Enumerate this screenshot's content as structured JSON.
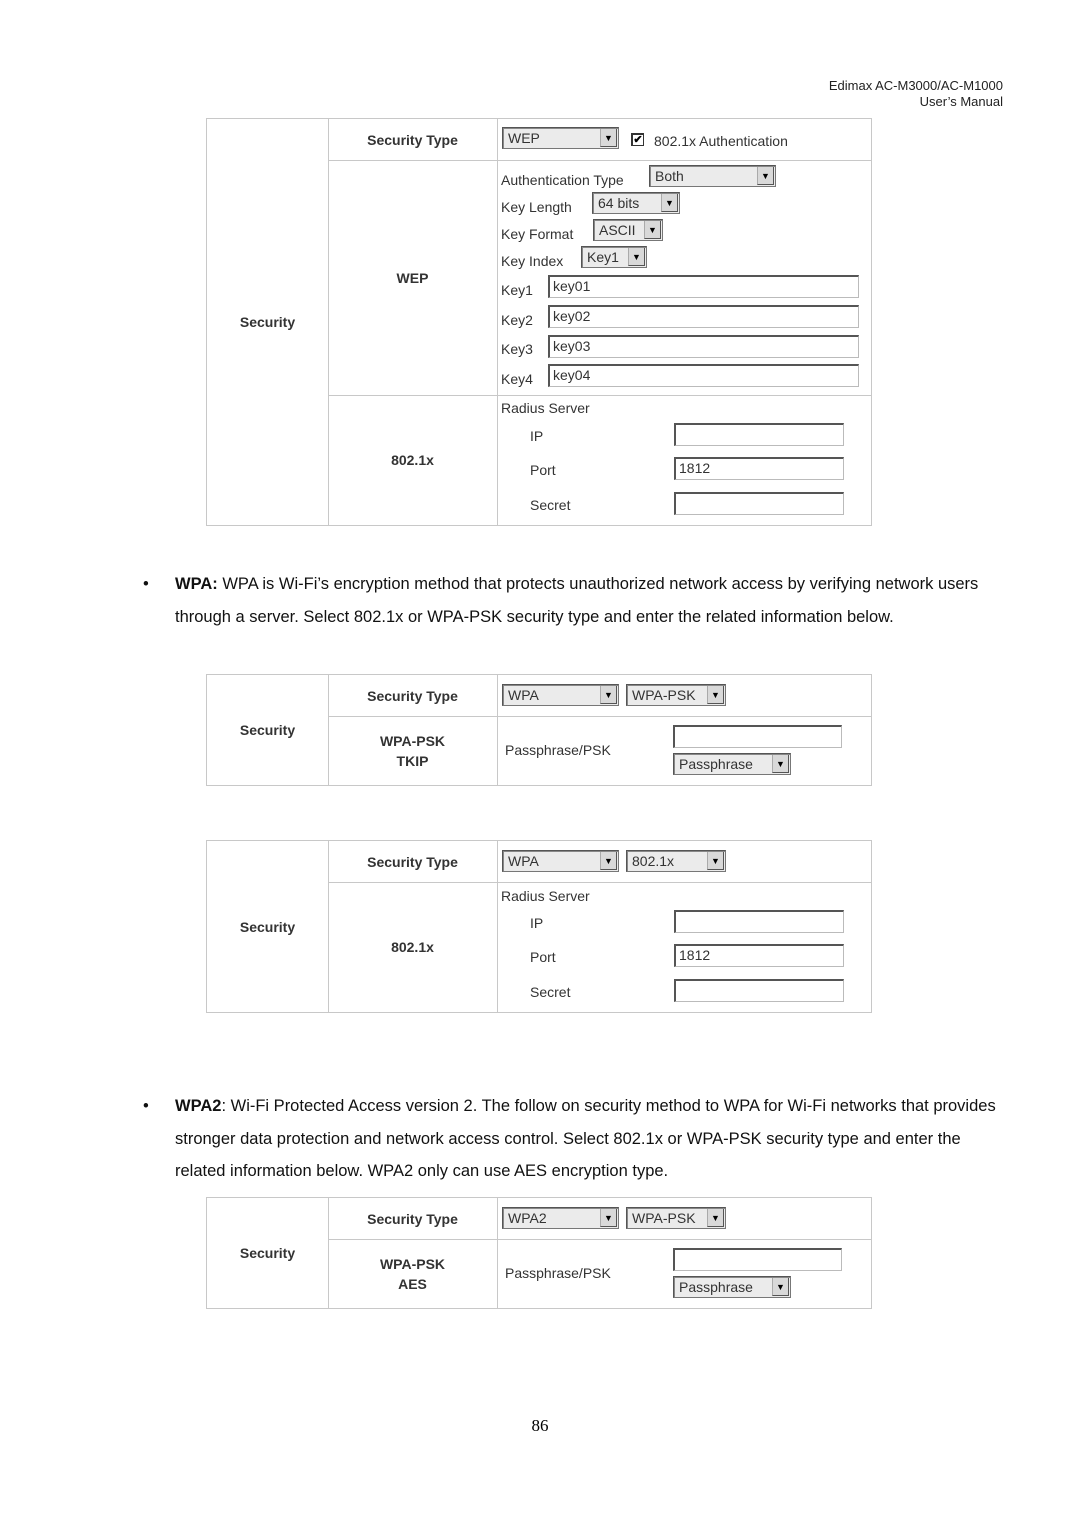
{
  "header": {
    "line1": "Edimax  AC-M3000/AC-M1000",
    "line2": "User’s  Manual"
  },
  "icons": {
    "dropdown": "▼",
    "checkbox_checked": "✔"
  },
  "wep_panel": {
    "section_label": "Security",
    "security_type_label": "Security Type",
    "security_type_value": "WEP",
    "auth_8021x_checked": true,
    "auth_8021x_label": "802.1x Authentication",
    "wep_label": "WEP",
    "auth_type_label": "Authentication Type",
    "auth_type_value": "Both",
    "key_length_label": "Key Length",
    "key_length_value": "64 bits",
    "key_format_label": "Key Format",
    "key_format_value": "ASCII",
    "key_index_label": "Key Index",
    "key_index_value": "Key1",
    "keys": [
      {
        "label": "Key1",
        "value": "key01"
      },
      {
        "label": "Key2",
        "value": "key02"
      },
      {
        "label": "Key3",
        "value": "key03"
      },
      {
        "label": "Key4",
        "value": "key04"
      }
    ],
    "dot1x_label": "802.1x",
    "radius_label": "Radius Server",
    "ip_label": "IP",
    "ip_value": "",
    "port_label": "Port",
    "port_value": "1812",
    "secret_label": "Secret",
    "secret_value": ""
  },
  "wpa_paragraph": {
    "bullet": "•",
    "lead": "WPA:",
    "text": " WPA is Wi-Fi’s encryption method that protects unauthorized network access by verifying network users through a server. Select 802.1x or WPA-PSK security type and enter the related information below."
  },
  "wpa_psk_panel": {
    "section_label": "Security",
    "security_type_label": "Security Type",
    "security_type_value": "WPA",
    "mode_value": "WPA-PSK",
    "mode_label_line1": "WPA-PSK",
    "mode_label_line2": "TKIP",
    "passphrase_label": "Passphrase/PSK",
    "passphrase_value": "",
    "passphrase_format_value": "Passphrase"
  },
  "wpa_8021x_panel": {
    "section_label": "Security",
    "security_type_label": "Security Type",
    "security_type_value": "WPA",
    "mode_value": "802.1x",
    "dot1x_label": "802.1x",
    "radius_label": "Radius Server",
    "ip_label": "IP",
    "ip_value": "",
    "port_label": "Port",
    "port_value": "1812",
    "secret_label": "Secret",
    "secret_value": ""
  },
  "wpa2_paragraph": {
    "bullet": "•",
    "lead": "WPA2",
    "text": ": Wi-Fi Protected Access version 2. The follow on security method to WPA for Wi-Fi networks that provides stronger data protection and network access control. Select 802.1x or WPA-PSK security type and enter the related information below. WPA2 only can use AES encryption type."
  },
  "wpa2_psk_panel": {
    "section_label": "Security",
    "security_type_label": "Security Type",
    "security_type_value": "WPA2",
    "mode_value": "WPA-PSK",
    "mode_label_line1": "WPA-PSK",
    "mode_label_line2": "AES",
    "passphrase_label": "Passphrase/PSK",
    "passphrase_value": "",
    "passphrase_format_value": "Passphrase"
  },
  "footer": {
    "page_number": "86"
  }
}
